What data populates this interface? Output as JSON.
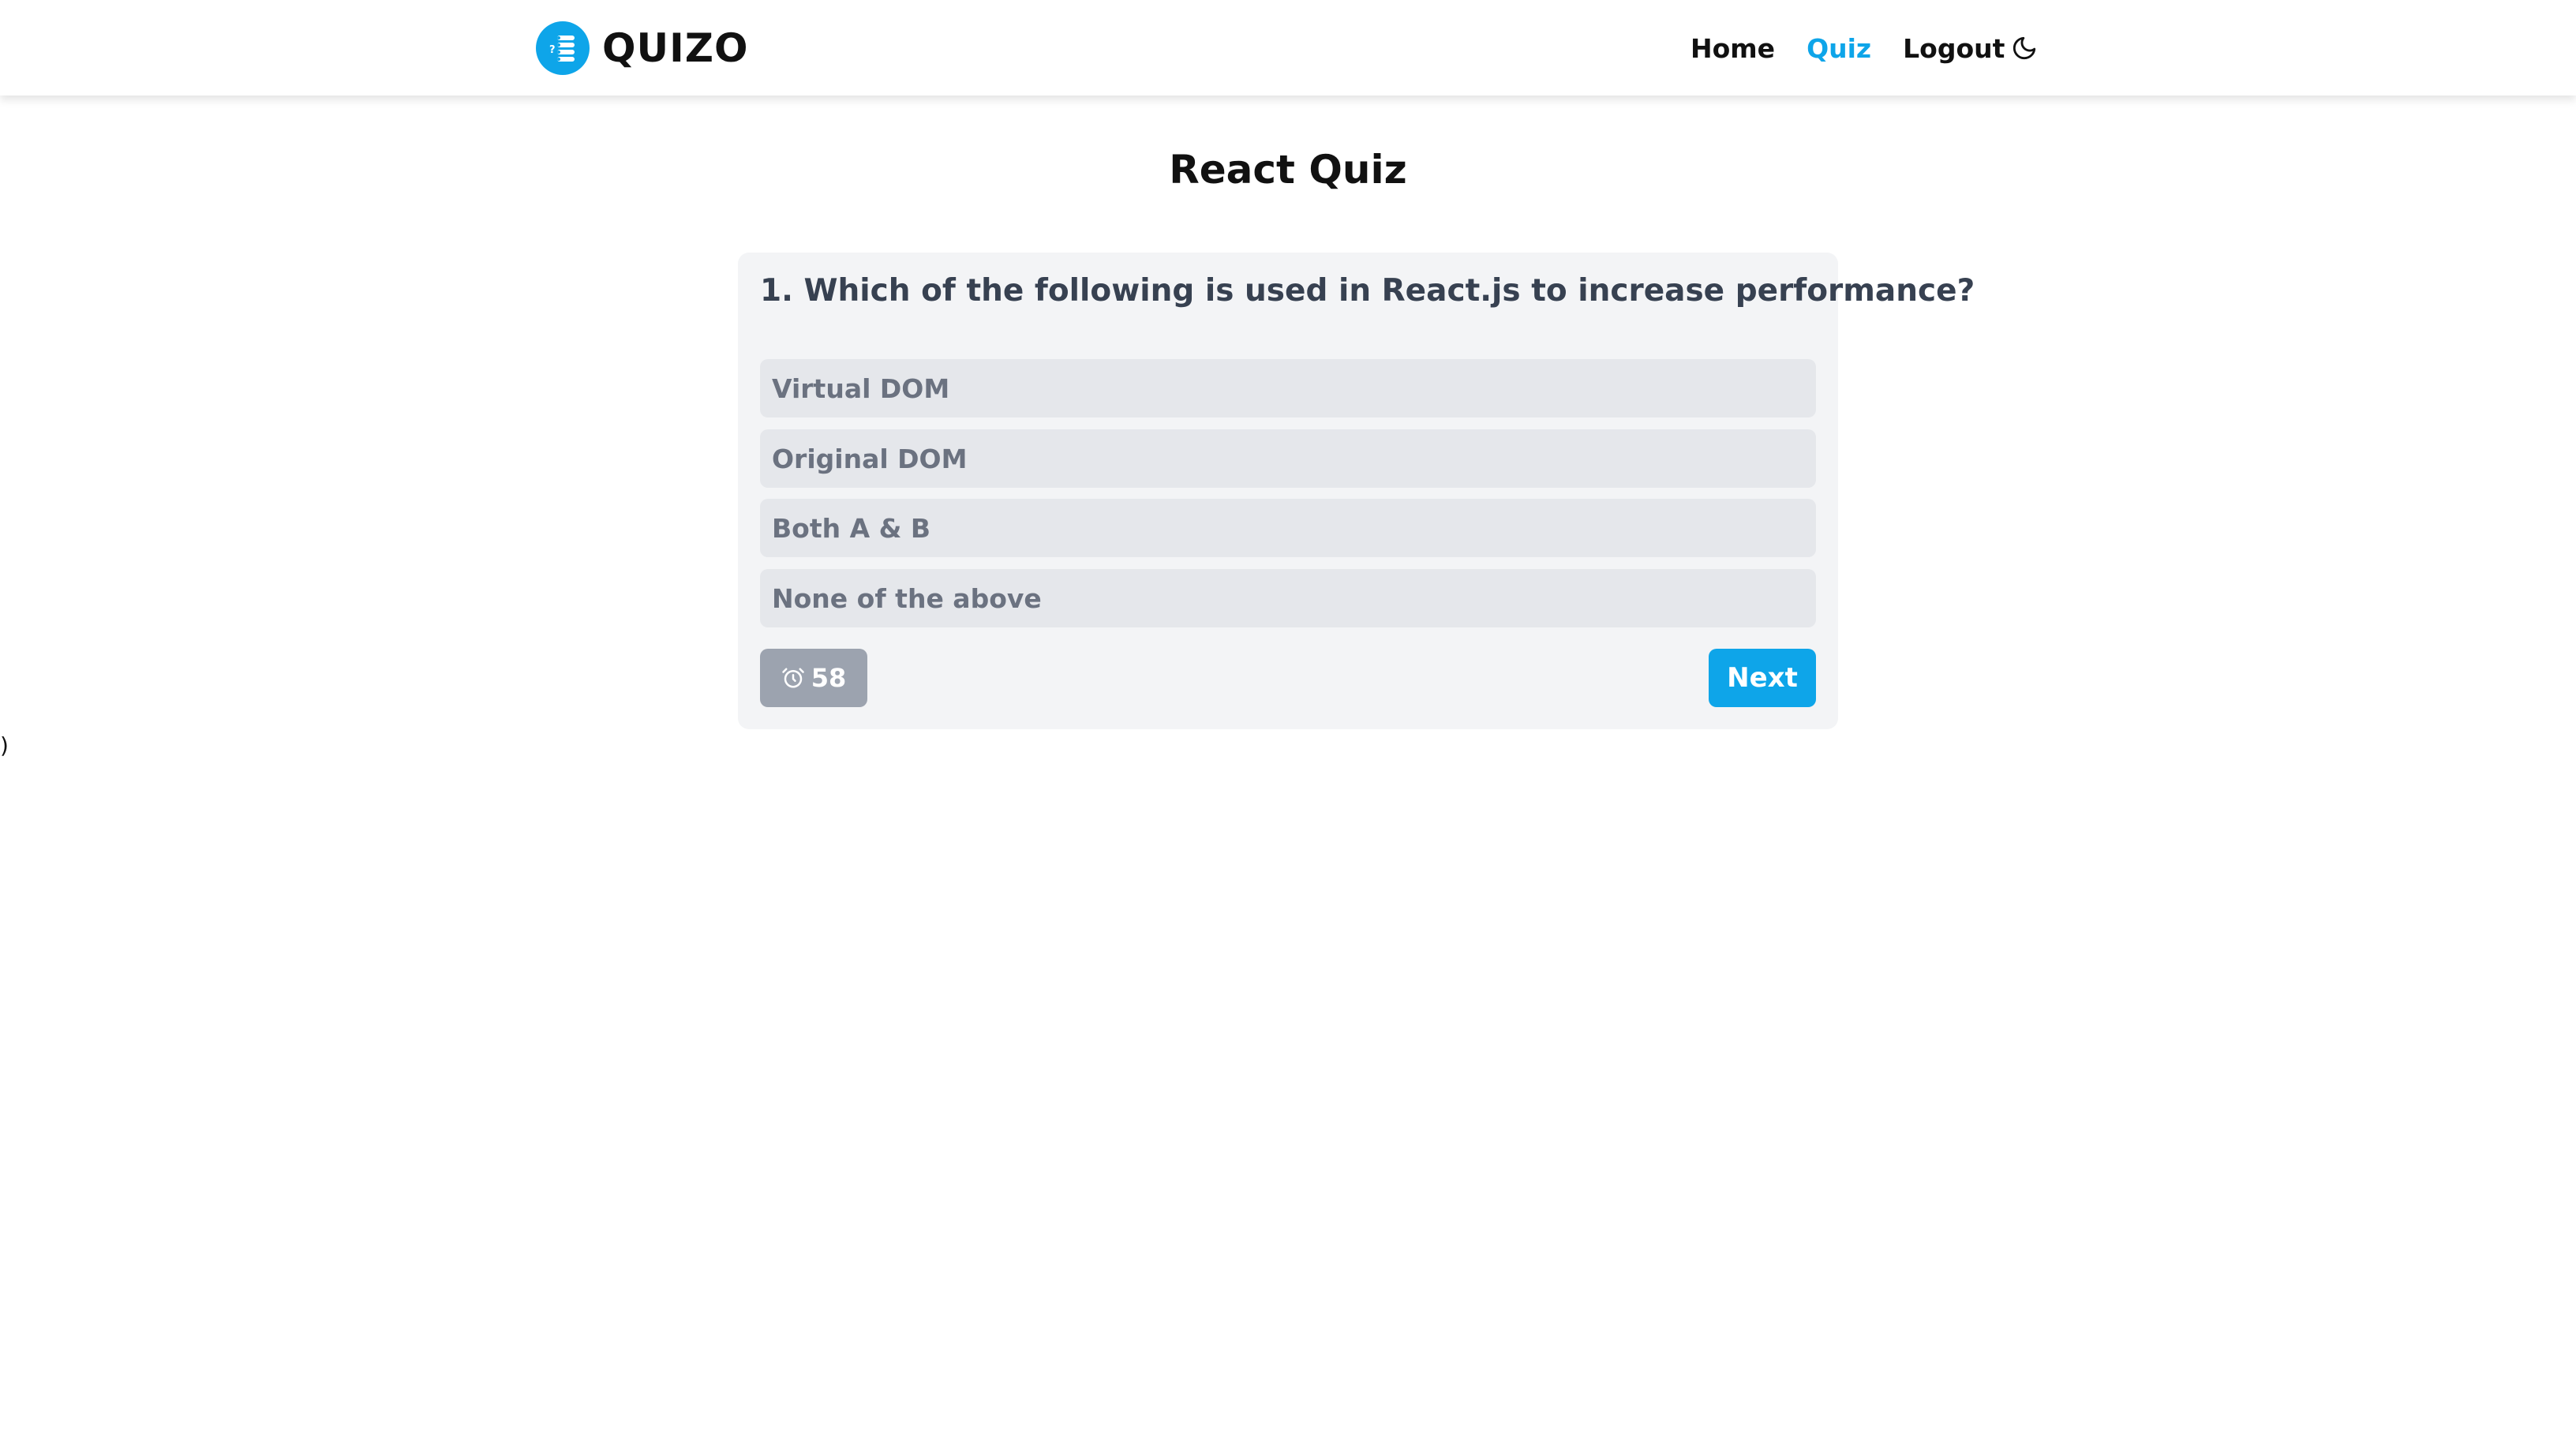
{
  "brand": {
    "name": "QUIZO",
    "logo_icon": "quiz-list-icon"
  },
  "nav": {
    "items": [
      {
        "label": "Home",
        "active": false
      },
      {
        "label": "Quiz",
        "active": true
      },
      {
        "label": "Logout",
        "active": false
      }
    ],
    "theme_toggle_icon": "moon-icon"
  },
  "page": {
    "title": "React Quiz",
    "stray_text": ")"
  },
  "quiz": {
    "question": "1. Which of the following is used in React.js to increase performance?",
    "options": [
      "Virtual DOM",
      "Original DOM",
      "Both A & B",
      "None of the above"
    ],
    "timer_icon": "alarm-clock-icon",
    "timer_value": "58",
    "next_label": "Next"
  },
  "colors": {
    "accent": "#0ea5e9",
    "card_bg": "#f3f4f6",
    "option_bg": "#e5e7eb",
    "option_text": "#6b7280",
    "timer_bg": "#9ca3af",
    "question_text": "#374151"
  }
}
